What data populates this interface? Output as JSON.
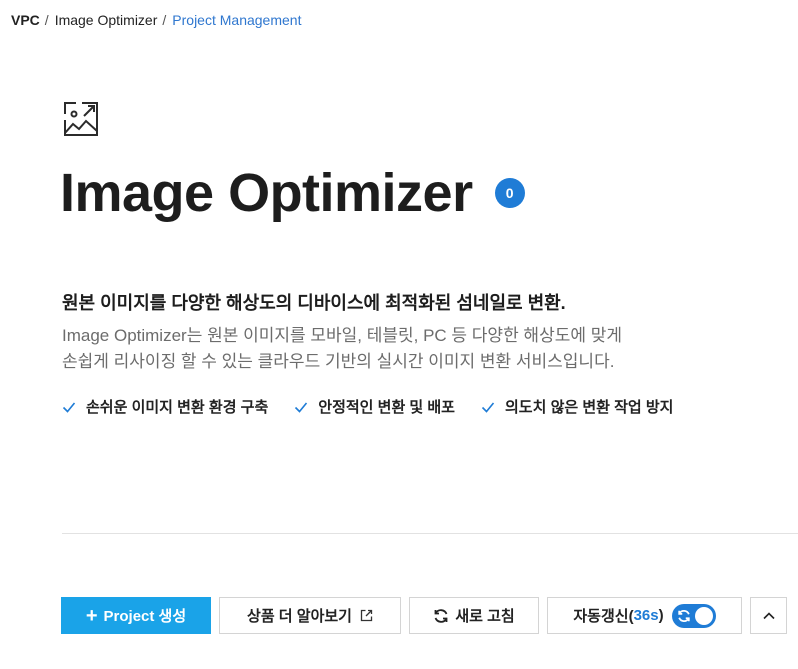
{
  "breadcrumb": {
    "root": "VPC",
    "separator": "/",
    "parent": "Image Optimizer",
    "current": "Project Management"
  },
  "header": {
    "icon": "image-optimize-icon",
    "title": "Image Optimizer",
    "count": "0"
  },
  "intro": {
    "headline": "원본 이미지를 다양한 해상도의 디바이스에 최적화된 섬네일로 변환.",
    "description_line1": "Image Optimizer는 원본 이미지를 모바일, 테블릿, PC 등 다양한 해상도에 맞게",
    "description_line2": "손쉽게 리사이징 할 수 있는 클라우드 기반의 실시간 이미지 변환 서비스입니다."
  },
  "features": [
    {
      "label": "손쉬운 이미지 변환 환경 구축",
      "icon": "check-icon"
    },
    {
      "label": "안정적인 변환 및 배포",
      "icon": "check-icon"
    },
    {
      "label": "의도치 않은 변환 작업 방지",
      "icon": "check-icon"
    }
  ],
  "actions": {
    "create_plus": "+",
    "create_label": "Project 생성",
    "learn_more_label": "상품 더 알아보기",
    "refresh_label": "새로 고침",
    "auto_refresh_label": "자동갱신(",
    "auto_refresh_seconds": "36s",
    "auto_refresh_close": ")",
    "auto_refresh_enabled": true
  },
  "colors": {
    "primary": "#1aa3e8",
    "accent": "#1f7cd6",
    "breadcrumb_current": "#2f77cf"
  }
}
